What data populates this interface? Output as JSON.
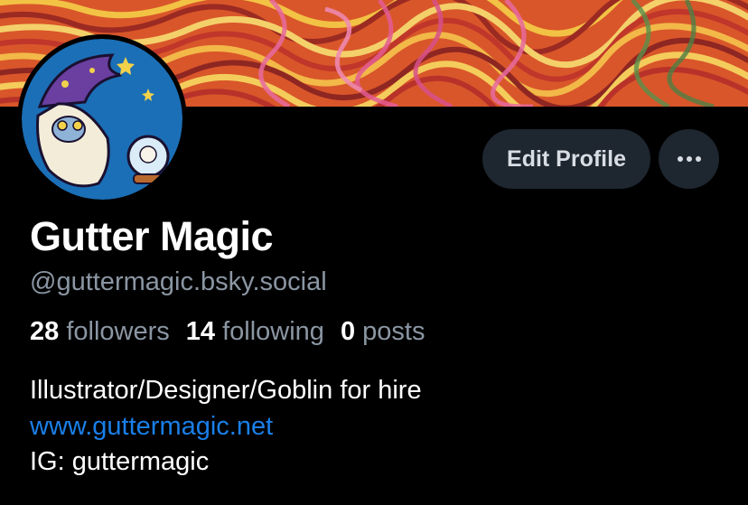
{
  "profile": {
    "display_name": "Gutter Magic",
    "handle": "@guttermagic.bsky.social"
  },
  "actions": {
    "edit_profile_label": "Edit Profile",
    "more_icon": "ellipsis-icon"
  },
  "stats": [
    {
      "value": "28",
      "label": "followers"
    },
    {
      "value": "14",
      "label": "following"
    },
    {
      "value": "0",
      "label": "posts"
    }
  ],
  "bio": {
    "line1": "Illustrator/Designer/Goblin for hire",
    "link": "www.guttermagic.net",
    "line3": "IG: guttermagic"
  },
  "colors": {
    "background": "#000000",
    "button_bg": "#1e2630",
    "secondary_text": "#8b96a3",
    "link": "#1a7fe8"
  }
}
